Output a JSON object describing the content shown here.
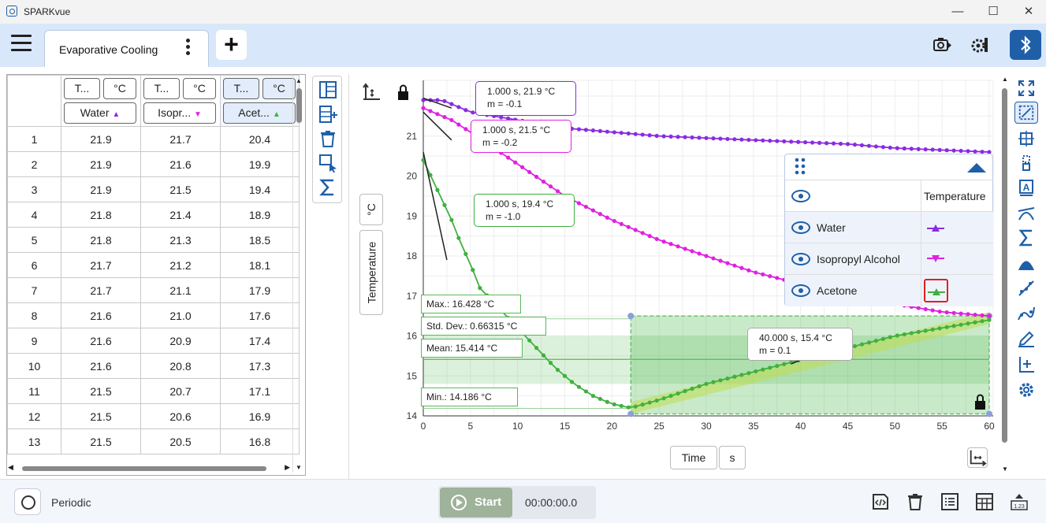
{
  "window": {
    "title": "SPARKvue",
    "min": "—",
    "max": "☐",
    "close": "✕"
  },
  "tab": {
    "label": "Evaporative Cooling"
  },
  "table": {
    "headers": [
      {
        "measure": "T...",
        "unit": "°C",
        "series": "Water",
        "marker": "▲",
        "color": "#8a2be2"
      },
      {
        "measure": "T...",
        "unit": "°C",
        "series": "Isopr...",
        "marker": "▼",
        "color": "#e020e0"
      },
      {
        "measure": "T...",
        "unit": "°C",
        "series": "Acet...",
        "marker": "▲",
        "color": "#40b040"
      }
    ],
    "rows": [
      [
        "1",
        "21.9",
        "21.7",
        "20.4"
      ],
      [
        "2",
        "21.9",
        "21.6",
        "19.9"
      ],
      [
        "3",
        "21.9",
        "21.5",
        "19.4"
      ],
      [
        "4",
        "21.8",
        "21.4",
        "18.9"
      ],
      [
        "5",
        "21.8",
        "21.3",
        "18.5"
      ],
      [
        "6",
        "21.7",
        "21.2",
        "18.1"
      ],
      [
        "7",
        "21.7",
        "21.1",
        "17.9"
      ],
      [
        "8",
        "21.6",
        "21.0",
        "17.6"
      ],
      [
        "9",
        "21.6",
        "20.9",
        "17.4"
      ],
      [
        "10",
        "21.6",
        "20.8",
        "17.3"
      ],
      [
        "11",
        "21.5",
        "20.7",
        "17.1"
      ],
      [
        "12",
        "21.5",
        "20.6",
        "16.9"
      ],
      [
        "13",
        "21.5",
        "20.5",
        "16.8"
      ]
    ]
  },
  "graph": {
    "y_unit": "°C",
    "y_label": "Temperature",
    "x_label": "Time",
    "x_unit": "s",
    "callouts": [
      {
        "line1": "1.000 s, 21.9 °C",
        "line2": "m = -0.1",
        "color": "#8a2be2"
      },
      {
        "line1": "1.000 s, 21.5 °C",
        "line2": "m = -0.2",
        "color": "#e020e0"
      },
      {
        "line1": "1.000 s, 19.4 °C",
        "line2": "m = -1.0",
        "color": "#40b040"
      },
      {
        "line1": "40.000 s, 15.4 °C",
        "line2": "m = 0.1",
        "color": "#aaaaaa"
      }
    ],
    "stats": {
      "max": "Max.: 16.428 °C",
      "std": "Std. Dev.: 0.66315 °C",
      "mean": "Mean: 15.414 °C",
      "min": "Min.: 14.186 °C"
    }
  },
  "chart_data": {
    "type": "line",
    "xlabel": "Time",
    "ylabel": "Temperature",
    "xlim": [
      0,
      60
    ],
    "ylim": [
      14,
      22
    ],
    "xticks": [
      0,
      5,
      10,
      15,
      20,
      25,
      30,
      35,
      40,
      45,
      50,
      55,
      60
    ],
    "yticks": [
      14,
      15,
      16,
      17,
      18,
      19,
      20,
      21
    ],
    "grid": true,
    "legend": "top-right",
    "series": [
      {
        "name": "Water",
        "color": "#8a2be2",
        "marker": "triangle-up",
        "x": [
          0,
          1,
          2,
          3,
          5,
          10,
          15,
          20,
          25,
          30,
          35,
          40,
          45,
          50,
          55,
          60
        ],
        "y": [
          21.9,
          21.9,
          21.9,
          21.8,
          21.6,
          21.4,
          21.2,
          21.1,
          21.0,
          20.95,
          20.9,
          20.85,
          20.8,
          20.7,
          20.65,
          20.6
        ]
      },
      {
        "name": "Isopropyl Alcohol",
        "color": "#e020e0",
        "marker": "triangle-down",
        "x": [
          0,
          1,
          2,
          3,
          5,
          10,
          15,
          20,
          25,
          30,
          35,
          40,
          45,
          50,
          55,
          60
        ],
        "y": [
          21.7,
          21.6,
          21.5,
          21.4,
          21.1,
          20.3,
          19.5,
          18.9,
          18.4,
          18.0,
          17.6,
          17.3,
          17.0,
          16.8,
          16.6,
          16.5
        ]
      },
      {
        "name": "Acetone",
        "color": "#40b040",
        "marker": "triangle-up",
        "x": [
          0,
          1,
          2,
          3,
          4,
          5,
          6,
          8,
          10,
          12,
          14,
          16,
          18,
          20,
          22,
          25,
          30,
          35,
          40,
          45,
          50,
          55,
          60
        ],
        "y": [
          20.4,
          19.9,
          19.4,
          18.9,
          18.3,
          17.8,
          17.2,
          16.7,
          16.2,
          15.7,
          15.2,
          14.8,
          14.5,
          14.3,
          14.2,
          14.4,
          14.8,
          15.1,
          15.4,
          15.7,
          16.0,
          16.2,
          16.4
        ]
      }
    ]
  },
  "legend": {
    "column_header": "Temperature",
    "items": [
      {
        "name": "Water",
        "marker": "▲",
        "color": "#8a2be2"
      },
      {
        "name": "Isopropyl Alcohol",
        "marker": "▼",
        "color": "#e020e0"
      },
      {
        "name": "Acetone",
        "marker": "▲",
        "color": "#40b040"
      }
    ]
  },
  "footer": {
    "mode": "Periodic",
    "start": "Start",
    "timer": "00:00:00.0"
  }
}
